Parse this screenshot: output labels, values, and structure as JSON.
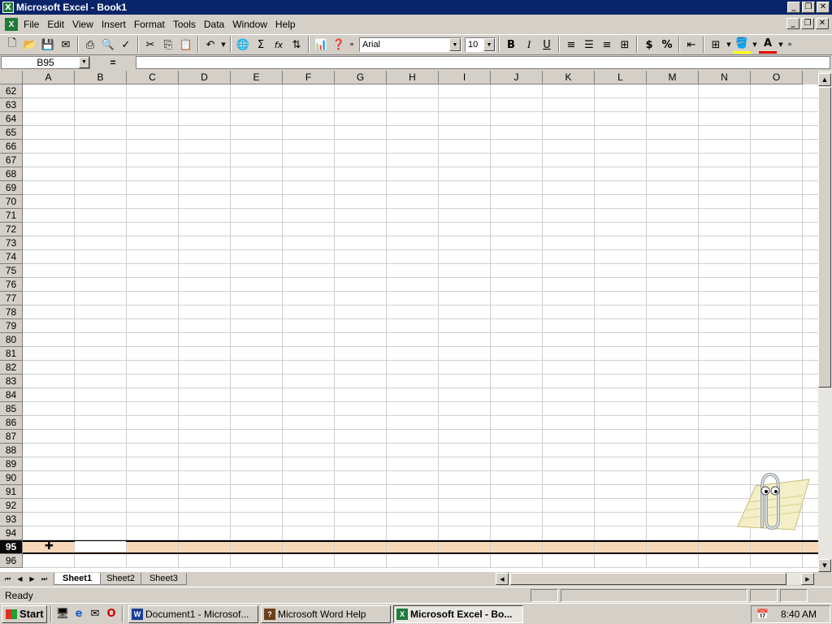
{
  "app": {
    "title": "Microsoft Excel - Book1",
    "caption_buttons": [
      "_",
      "❐",
      "✕"
    ],
    "doc_buttons": [
      "_",
      "❐",
      "✕"
    ]
  },
  "menubar": {
    "items": [
      "File",
      "Edit",
      "View",
      "Insert",
      "Format",
      "Tools",
      "Data",
      "Window",
      "Help"
    ]
  },
  "toolbar": {
    "font_name": "Arial",
    "font_size": "10",
    "bold_label": "B",
    "italic_label": "I",
    "underline_label": "U",
    "currency_label": "$",
    "percent_label": "%",
    "sum_label": "Σ",
    "function_label": "fx"
  },
  "formula_bar": {
    "name_box": "B95",
    "equals": "=",
    "formula": ""
  },
  "grid": {
    "columns": [
      "A",
      "B",
      "C",
      "D",
      "E",
      "F",
      "G",
      "H",
      "I",
      "J",
      "K",
      "L",
      "M",
      "N",
      "O"
    ],
    "rows": [
      "62",
      "63",
      "64",
      "65",
      "66",
      "67",
      "68",
      "69",
      "70",
      "71",
      "72",
      "73",
      "74",
      "75",
      "76",
      "77",
      "78",
      "79",
      "80",
      "81",
      "82",
      "83",
      "84",
      "85",
      "86",
      "87",
      "88",
      "89",
      "90",
      "91",
      "92",
      "93",
      "94",
      "95",
      "96"
    ],
    "selected_row": "95",
    "active_cell": "B95"
  },
  "sheets": {
    "tabs": [
      "Sheet1",
      "Sheet2",
      "Sheet3"
    ],
    "active": "Sheet1"
  },
  "status": {
    "text": "Ready"
  },
  "taskbar": {
    "start_label": "Start",
    "tasks": [
      {
        "label": "Document1 - Microsof...",
        "icon": "W",
        "color": "#1a3f9a"
      },
      {
        "label": "Microsoft Word Help",
        "icon": "?",
        "color": "#6b3f1a"
      },
      {
        "label": "Microsoft Excel - Bo...",
        "icon": "X",
        "color": "#1e7b3a"
      }
    ],
    "clock": "8:40 AM"
  },
  "colors": {
    "title_bar": "#0a246a",
    "selected_row_fill": "#f6d8b8",
    "chrome": "#d4d0c8"
  }
}
